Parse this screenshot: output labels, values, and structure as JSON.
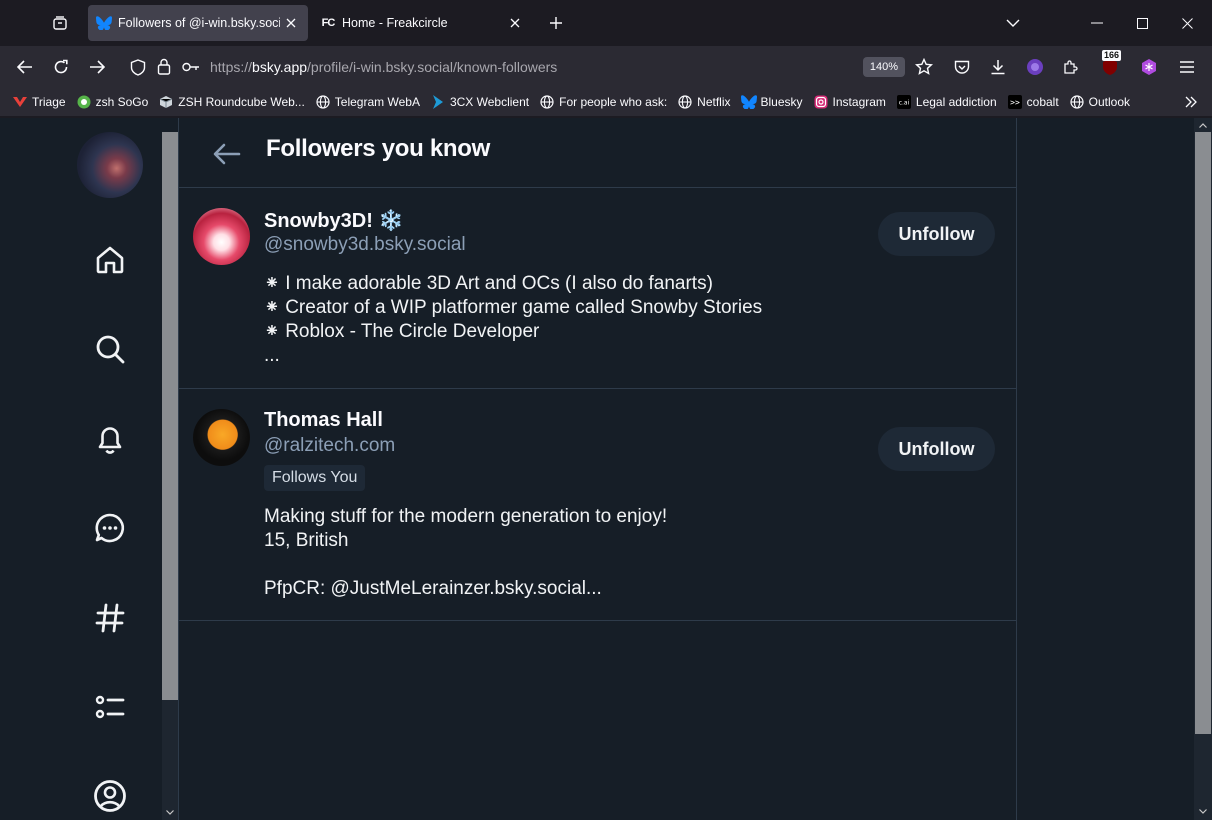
{
  "browser": {
    "tabs": [
      {
        "title": "Followers of @i-win.bsky.social",
        "active": true,
        "favicon": "bluesky-butterfly-icon"
      },
      {
        "title": "Home - Freakcircle",
        "active": false,
        "favicon": "freakcircle-fc-icon"
      }
    ],
    "url": {
      "scheme": "https://",
      "host": "bsky.app",
      "path": "/profile/i-win.bsky.social/known-followers"
    },
    "zoom": "140%",
    "extension_badge": "166",
    "bookmarks": [
      {
        "label": "Triage",
        "icon": "triage-icon"
      },
      {
        "label": "zsh SoGo",
        "icon": "sogo-icon"
      },
      {
        "label": "ZSH Roundcube Web...",
        "icon": "roundcube-icon"
      },
      {
        "label": "Telegram WebA",
        "icon": "globe-icon"
      },
      {
        "label": "3CX Webclient",
        "icon": "3cx-icon"
      },
      {
        "label": "For people who ask:",
        "icon": "globe-icon"
      },
      {
        "label": "Netflix",
        "icon": "globe-icon"
      },
      {
        "label": "Bluesky",
        "icon": "bluesky-butterfly-icon"
      },
      {
        "label": "Instagram",
        "icon": "instagram-icon"
      },
      {
        "label": "Legal addiction",
        "icon": "cai-icon"
      },
      {
        "label": "cobalt",
        "icon": "cobalt-icon"
      },
      {
        "label": "Outlook",
        "icon": "globe-icon"
      }
    ]
  },
  "page": {
    "title": "Followers you know",
    "nav_icons": [
      "home-icon",
      "search-icon",
      "bell-icon",
      "chat-icon",
      "hashtag-icon",
      "lists-icon",
      "profile-icon"
    ],
    "followers": [
      {
        "name": "Snowby3D! ❄️",
        "handle": "@snowby3d.bsky.social",
        "button": "Unfollow",
        "bio": "⁕ I make adorable 3D Art and OCs (I also do fanarts)\n⁕ Creator of a WIP platformer game called Snowby Stories\n⁕ Roblox - The Circle Developer\n..."
      },
      {
        "name": "Thomas Hall",
        "handle": "@ralzitech.com",
        "badge": "Follows You",
        "button": "Unfollow",
        "bio": "Making stuff for the modern generation to enjoy!\n15, British\n\nPfpCR: @JustMeLerainzer.bsky.social..."
      }
    ]
  },
  "colors": {
    "page_bg": "#161e27",
    "border": "#2e3b4a",
    "handle": "#8c9fb6",
    "button_bg": "#1e2936",
    "bluesky_blue": "#1185fe"
  }
}
